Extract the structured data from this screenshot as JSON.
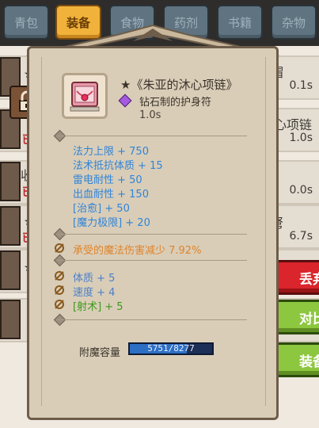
{
  "tabs": [
    {
      "label": "青包"
    },
    {
      "label": "装备"
    },
    {
      "label": "食物"
    },
    {
      "label": "药剂"
    },
    {
      "label": "书籍"
    },
    {
      "label": "杂物"
    }
  ],
  "background_list": {
    "rows": [
      {
        "title": "帽",
        "time": "0.1s"
      },
      {
        "title": "木心项链",
        "time": "1.0s"
      },
      {
        "title": "收",
        "red": "已",
        "time": "0.0s"
      },
      {
        "title": "弩",
        "time": "6.7s"
      }
    ]
  },
  "side_buttons": {
    "discard": "丢弃",
    "compare": "对比",
    "equip": "装备"
  },
  "item": {
    "name": "★《朱亚的沐心项链》",
    "type": "钻石制的护身符",
    "time": "1.0s",
    "stats_primary": [
      "法力上限 + 750",
      "法术抵抗体质 + 15",
      "雷电耐性 + 50",
      "出血耐性 + 150",
      "[治愈] + 50",
      "[魔力极限] + 20"
    ],
    "stat_special": "承受的魔法伤害减少 7.92%",
    "stats_attr": [
      {
        "text": "体质 + 5",
        "color": "blue"
      },
      {
        "text": "速度 + 4",
        "color": "blue"
      },
      {
        "text": "[射术] + 5",
        "color": "green"
      }
    ],
    "capacity_label": "附魔容量",
    "capacity_text": "5751/8277",
    "capacity_fraction": 0.695
  },
  "colors": {
    "stat_blue": "#2f84d8",
    "stat_orange": "#e0842a",
    "stat_green": "#3d9a1a",
    "tab_active": "#f0b23a",
    "button_red": "#d9252b",
    "button_green": "#8dc63f"
  },
  "icons": [
    "lock-icon",
    "necklace-icon",
    "gem-icon",
    "rune-icon",
    "diamond-bullet-icon"
  ]
}
